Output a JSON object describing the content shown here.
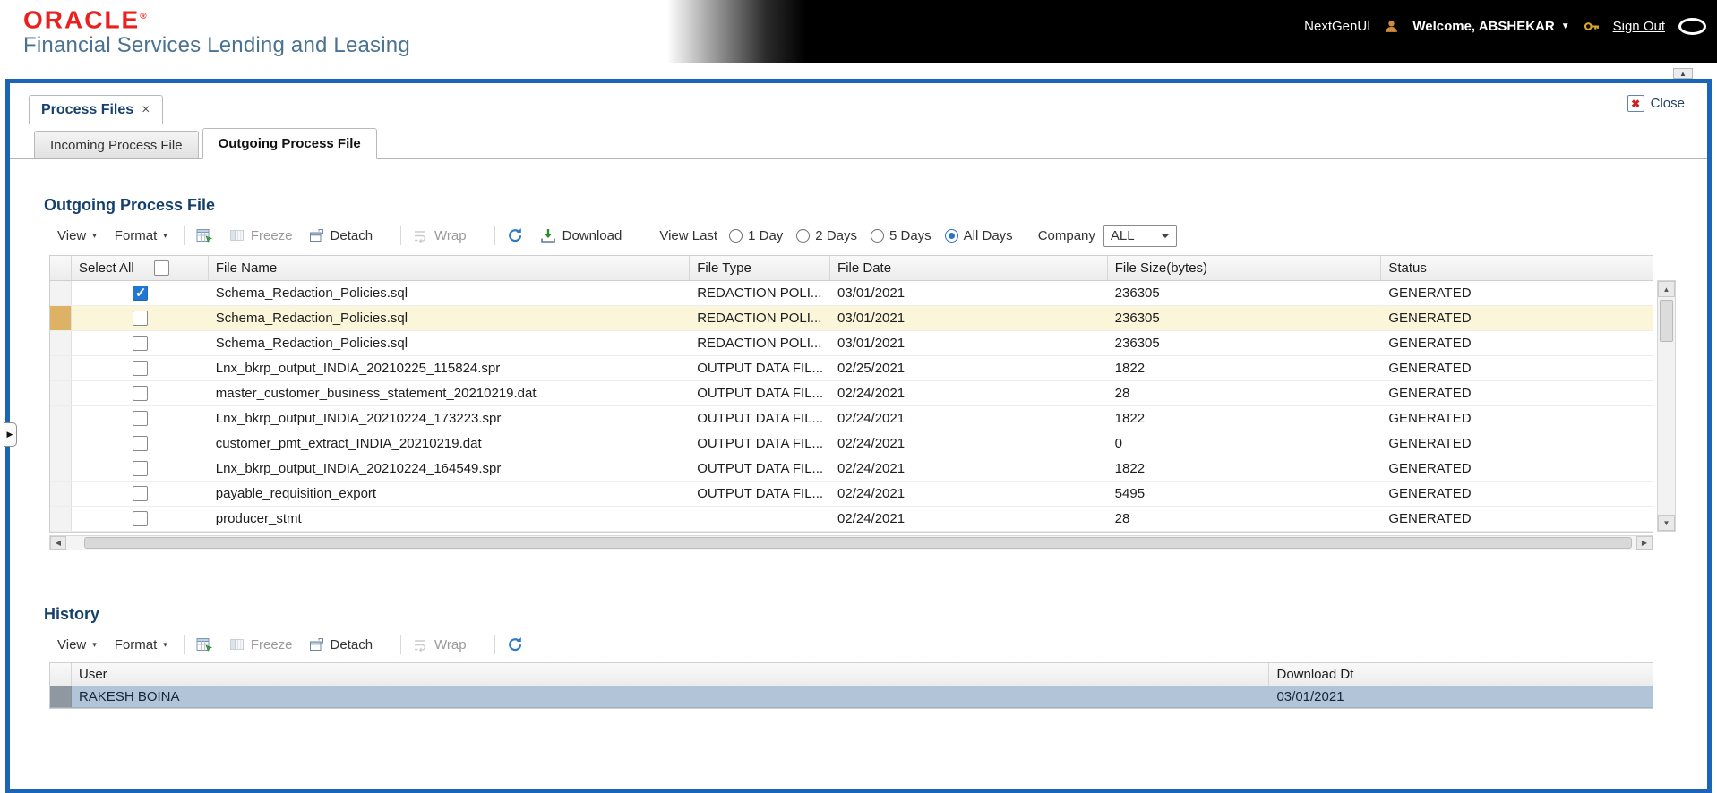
{
  "header": {
    "brand": "ORACLE",
    "registered": "®",
    "subtitle": "Financial Services Lending and Leasing",
    "nextgen_label": "NextGenUI",
    "welcome_label": "Welcome, ABSHEKAR",
    "signout_label": "Sign Out"
  },
  "panel": {
    "doc_tab": "Process Files",
    "doc_tab_close": "×",
    "close_icon": "✖",
    "close_label": "Close",
    "scroll_up_glyph": "▲",
    "collapse_glyph": "▶",
    "subtabs": [
      {
        "label": "Incoming Process File",
        "active": false
      },
      {
        "label": "Outgoing Process File",
        "active": true
      }
    ]
  },
  "outgoing": {
    "title": "Outgoing Process File",
    "toolbar": {
      "view": "View",
      "format": "Format",
      "freeze": "Freeze",
      "detach": "Detach",
      "wrap": "Wrap",
      "download": "Download"
    },
    "view_last_label": "View Last",
    "view_last_options": [
      {
        "label": "1 Day",
        "selected": false
      },
      {
        "label": "2 Days",
        "selected": false
      },
      {
        "label": "5 Days",
        "selected": false
      },
      {
        "label": "All Days",
        "selected": true
      }
    ],
    "company_label": "Company",
    "company_value": "ALL",
    "columns": [
      "Select All",
      "File Name",
      "File Type",
      "File Date",
      "File Size(bytes)",
      "Status"
    ],
    "rows": [
      {
        "checked": true,
        "highlighted": false,
        "file_name": "Schema_Redaction_Policies.sql",
        "file_type": "REDACTION POLI...",
        "file_date": "03/01/2021",
        "file_size": "236305",
        "status": "GENERATED"
      },
      {
        "checked": false,
        "highlighted": true,
        "file_name": "Schema_Redaction_Policies.sql",
        "file_type": "REDACTION POLI...",
        "file_date": "03/01/2021",
        "file_size": "236305",
        "status": "GENERATED"
      },
      {
        "checked": false,
        "highlighted": false,
        "file_name": "Schema_Redaction_Policies.sql",
        "file_type": "REDACTION POLI...",
        "file_date": "03/01/2021",
        "file_size": "236305",
        "status": "GENERATED"
      },
      {
        "checked": false,
        "highlighted": false,
        "file_name": "Lnx_bkrp_output_INDIA_20210225_115824.spr",
        "file_type": "OUTPUT DATA FIL...",
        "file_date": "02/25/2021",
        "file_size": "1822",
        "status": "GENERATED"
      },
      {
        "checked": false,
        "highlighted": false,
        "file_name": "master_customer_business_statement_20210219.dat",
        "file_type": "OUTPUT DATA FIL...",
        "file_date": "02/24/2021",
        "file_size": "28",
        "status": "GENERATED"
      },
      {
        "checked": false,
        "highlighted": false,
        "file_name": "Lnx_bkrp_output_INDIA_20210224_173223.spr",
        "file_type": "OUTPUT DATA FIL...",
        "file_date": "02/24/2021",
        "file_size": "1822",
        "status": "GENERATED"
      },
      {
        "checked": false,
        "highlighted": false,
        "file_name": "customer_pmt_extract_INDIA_20210219.dat",
        "file_type": "OUTPUT DATA FIL...",
        "file_date": "02/24/2021",
        "file_size": "0",
        "status": "GENERATED"
      },
      {
        "checked": false,
        "highlighted": false,
        "file_name": "Lnx_bkrp_output_INDIA_20210224_164549.spr",
        "file_type": "OUTPUT DATA FIL...",
        "file_date": "02/24/2021",
        "file_size": "1822",
        "status": "GENERATED"
      },
      {
        "checked": false,
        "highlighted": false,
        "file_name": "payable_requisition_export",
        "file_type": "OUTPUT DATA FIL...",
        "file_date": "02/24/2021",
        "file_size": "5495",
        "status": "GENERATED"
      },
      {
        "checked": false,
        "highlighted": false,
        "file_name": "producer_stmt",
        "file_type": "",
        "file_date": "02/24/2021",
        "file_size": "28",
        "status": "GENERATED"
      }
    ]
  },
  "history": {
    "title": "History",
    "toolbar": {
      "view": "View",
      "format": "Format",
      "freeze": "Freeze",
      "detach": "Detach",
      "wrap": "Wrap"
    },
    "columns": [
      "User",
      "Download Dt"
    ],
    "rows": [
      {
        "user": "RAKESH BOINA",
        "download_dt": "03/01/2021"
      }
    ]
  }
}
